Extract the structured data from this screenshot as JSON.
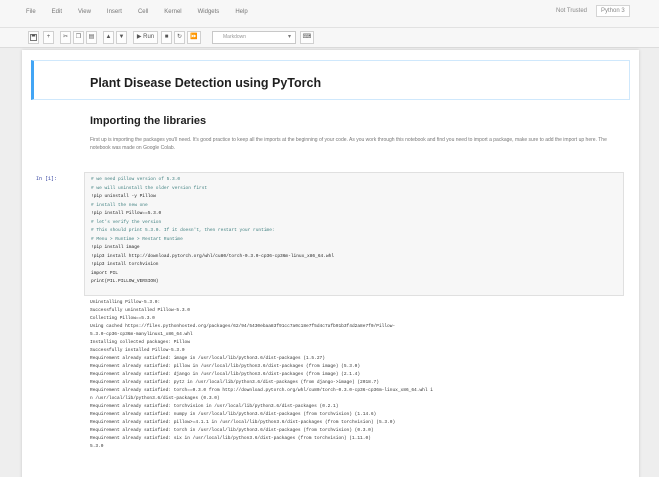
{
  "menu": {
    "items": [
      "File",
      "Edit",
      "View",
      "Insert",
      "Cell",
      "Kernel",
      "Widgets",
      "Help"
    ],
    "trusted": "Not Trusted",
    "kernel": "Python 3"
  },
  "toolbar": {
    "buttons": [
      "save-icon",
      "add-icon",
      "cut-icon",
      "copy-icon",
      "paste-icon",
      "move-up-icon",
      "move-down-icon"
    ],
    "run_label": "Run",
    "cell_type": "Markdown"
  },
  "notebook": {
    "title": "Plant Disease Detection using PyTorch",
    "section_heading": "Importing the libraries",
    "intro_text": "First up is importing the packages you'll need. It's good practice to keep all the imports at the beginning of your code. As you work through this notebook and find you need to import a package, make sure to add the import up here. The notebook was made on Google Colab.",
    "prompt": "In [1]:",
    "code_lines": [
      {
        "text": "# we need pillow version of 5.3.0",
        "kind": "comment"
      },
      {
        "text": "# we will uninstall the older version first",
        "kind": "comment"
      },
      {
        "text": "!pip uninstall -y Pillow",
        "kind": "code"
      },
      {
        "text": "# install the new one",
        "kind": "comment"
      },
      {
        "text": "!pip install Pillow==5.3.0",
        "kind": "code"
      },
      {
        "text": "# let's verify the version",
        "kind": "comment"
      },
      {
        "text": "# This should print 5.3.0. If it doesn't, then restart your runtime:",
        "kind": "comment"
      },
      {
        "text": "# Menu > Runtime > Restart Runtime",
        "kind": "comment"
      },
      {
        "text": "!pip install image",
        "kind": "code"
      },
      {
        "text": "!pip3 install http://download.pytorch.org/whl/cu80/torch-0.3.0-cp36-cp36m-linux_x86_64.whl",
        "kind": "code"
      },
      {
        "text": "!pip3 install torchvision",
        "kind": "code"
      },
      {
        "text": "import PIL",
        "kind": "code"
      },
      {
        "text": "print(PIL.PILLOW_VERSION)",
        "kind": "code"
      }
    ],
    "output_lines": [
      "Uninstalling Pillow-5.3.0:",
      "  Successfully uninstalled Pillow-5.3.0",
      "Collecting Pillow==5.3.0",
      "  Using cached https://files.pythonhosted.org/packages/62/94/5430ebaa83f91cc7a0c18e7f5d4c7afb91b3f4d2a8e7f0/Pillow-",
      "5.3.0-cp36-cp36m-manylinux1_x86_64.whl",
      "Installing collected packages: Pillow",
      "Successfully installed Pillow-5.3.0",
      "Requirement already satisfied: image in /usr/local/lib/python3.6/dist-packages (1.5.27)",
      "Requirement already satisfied: pillow in /usr/local/lib/python3.6/dist-packages (from image) (5.3.0)",
      "Requirement already satisfied: django in /usr/local/lib/python3.6/dist-packages (from image) (2.1.4)",
      "Requirement already satisfied: pytz in /usr/local/lib/python3.6/dist-packages (from django->image) (2018.7)",
      "Requirement already satisfied: torch==0.3.0 from http://download.pytorch.org/whl/cu80/torch-0.3.0-cp36-cp36m-linux_x86_64.whl i",
      "n /usr/local/lib/python3.6/dist-packages (0.3.0)",
      "Requirement already satisfied: torchvision in /usr/local/lib/python3.6/dist-packages (0.2.1)",
      "Requirement already satisfied: numpy in /usr/local/lib/python3.6/dist-packages (from torchvision) (1.14.6)",
      "Requirement already satisfied: pillow>=4.1.1 in /usr/local/lib/python3.6/dist-packages (from torchvision) (5.3.0)",
      "Requirement already satisfied: torch in /usr/local/lib/python3.6/dist-packages (from torchvision) (0.3.0)",
      "Requirement already satisfied: six in /usr/local/lib/python3.6/dist-packages (from torchvision) (1.11.0)",
      "5.3.0"
    ]
  }
}
